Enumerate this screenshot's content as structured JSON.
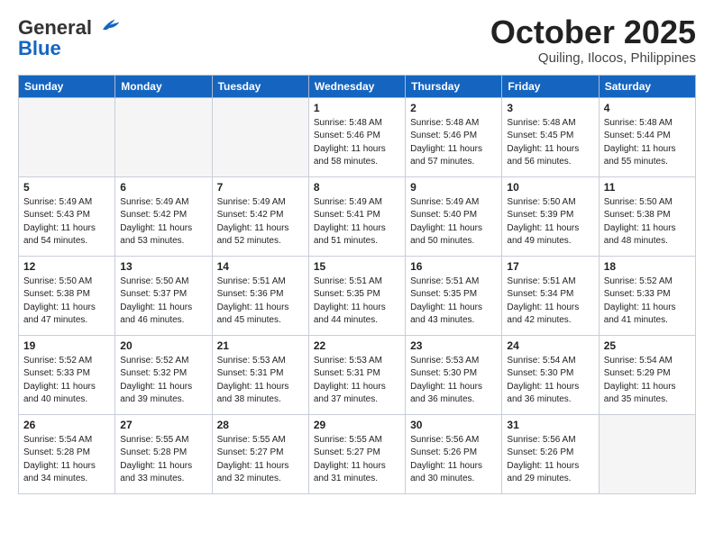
{
  "header": {
    "logo_general": "General",
    "logo_blue": "Blue",
    "month_title": "October 2025",
    "location": "Quiling, Ilocos, Philippines"
  },
  "days_of_week": [
    "Sunday",
    "Monday",
    "Tuesday",
    "Wednesday",
    "Thursday",
    "Friday",
    "Saturday"
  ],
  "weeks": [
    [
      {
        "day": "",
        "empty": true
      },
      {
        "day": "",
        "empty": true
      },
      {
        "day": "",
        "empty": true
      },
      {
        "day": "1",
        "sunrise": "Sunrise: 5:48 AM",
        "sunset": "Sunset: 5:46 PM",
        "daylight": "Daylight: 11 hours and 58 minutes."
      },
      {
        "day": "2",
        "sunrise": "Sunrise: 5:48 AM",
        "sunset": "Sunset: 5:46 PM",
        "daylight": "Daylight: 11 hours and 57 minutes."
      },
      {
        "day": "3",
        "sunrise": "Sunrise: 5:48 AM",
        "sunset": "Sunset: 5:45 PM",
        "daylight": "Daylight: 11 hours and 56 minutes."
      },
      {
        "day": "4",
        "sunrise": "Sunrise: 5:48 AM",
        "sunset": "Sunset: 5:44 PM",
        "daylight": "Daylight: 11 hours and 55 minutes."
      }
    ],
    [
      {
        "day": "5",
        "sunrise": "Sunrise: 5:49 AM",
        "sunset": "Sunset: 5:43 PM",
        "daylight": "Daylight: 11 hours and 54 minutes."
      },
      {
        "day": "6",
        "sunrise": "Sunrise: 5:49 AM",
        "sunset": "Sunset: 5:42 PM",
        "daylight": "Daylight: 11 hours and 53 minutes."
      },
      {
        "day": "7",
        "sunrise": "Sunrise: 5:49 AM",
        "sunset": "Sunset: 5:42 PM",
        "daylight": "Daylight: 11 hours and 52 minutes."
      },
      {
        "day": "8",
        "sunrise": "Sunrise: 5:49 AM",
        "sunset": "Sunset: 5:41 PM",
        "daylight": "Daylight: 11 hours and 51 minutes."
      },
      {
        "day": "9",
        "sunrise": "Sunrise: 5:49 AM",
        "sunset": "Sunset: 5:40 PM",
        "daylight": "Daylight: 11 hours and 50 minutes."
      },
      {
        "day": "10",
        "sunrise": "Sunrise: 5:50 AM",
        "sunset": "Sunset: 5:39 PM",
        "daylight": "Daylight: 11 hours and 49 minutes."
      },
      {
        "day": "11",
        "sunrise": "Sunrise: 5:50 AM",
        "sunset": "Sunset: 5:38 PM",
        "daylight": "Daylight: 11 hours and 48 minutes."
      }
    ],
    [
      {
        "day": "12",
        "sunrise": "Sunrise: 5:50 AM",
        "sunset": "Sunset: 5:38 PM",
        "daylight": "Daylight: 11 hours and 47 minutes."
      },
      {
        "day": "13",
        "sunrise": "Sunrise: 5:50 AM",
        "sunset": "Sunset: 5:37 PM",
        "daylight": "Daylight: 11 hours and 46 minutes."
      },
      {
        "day": "14",
        "sunrise": "Sunrise: 5:51 AM",
        "sunset": "Sunset: 5:36 PM",
        "daylight": "Daylight: 11 hours and 45 minutes."
      },
      {
        "day": "15",
        "sunrise": "Sunrise: 5:51 AM",
        "sunset": "Sunset: 5:35 PM",
        "daylight": "Daylight: 11 hours and 44 minutes."
      },
      {
        "day": "16",
        "sunrise": "Sunrise: 5:51 AM",
        "sunset": "Sunset: 5:35 PM",
        "daylight": "Daylight: 11 hours and 43 minutes."
      },
      {
        "day": "17",
        "sunrise": "Sunrise: 5:51 AM",
        "sunset": "Sunset: 5:34 PM",
        "daylight": "Daylight: 11 hours and 42 minutes."
      },
      {
        "day": "18",
        "sunrise": "Sunrise: 5:52 AM",
        "sunset": "Sunset: 5:33 PM",
        "daylight": "Daylight: 11 hours and 41 minutes."
      }
    ],
    [
      {
        "day": "19",
        "sunrise": "Sunrise: 5:52 AM",
        "sunset": "Sunset: 5:33 PM",
        "daylight": "Daylight: 11 hours and 40 minutes."
      },
      {
        "day": "20",
        "sunrise": "Sunrise: 5:52 AM",
        "sunset": "Sunset: 5:32 PM",
        "daylight": "Daylight: 11 hours and 39 minutes."
      },
      {
        "day": "21",
        "sunrise": "Sunrise: 5:53 AM",
        "sunset": "Sunset: 5:31 PM",
        "daylight": "Daylight: 11 hours and 38 minutes."
      },
      {
        "day": "22",
        "sunrise": "Sunrise: 5:53 AM",
        "sunset": "Sunset: 5:31 PM",
        "daylight": "Daylight: 11 hours and 37 minutes."
      },
      {
        "day": "23",
        "sunrise": "Sunrise: 5:53 AM",
        "sunset": "Sunset: 5:30 PM",
        "daylight": "Daylight: 11 hours and 36 minutes."
      },
      {
        "day": "24",
        "sunrise": "Sunrise: 5:54 AM",
        "sunset": "Sunset: 5:30 PM",
        "daylight": "Daylight: 11 hours and 36 minutes."
      },
      {
        "day": "25",
        "sunrise": "Sunrise: 5:54 AM",
        "sunset": "Sunset: 5:29 PM",
        "daylight": "Daylight: 11 hours and 35 minutes."
      }
    ],
    [
      {
        "day": "26",
        "sunrise": "Sunrise: 5:54 AM",
        "sunset": "Sunset: 5:28 PM",
        "daylight": "Daylight: 11 hours and 34 minutes."
      },
      {
        "day": "27",
        "sunrise": "Sunrise: 5:55 AM",
        "sunset": "Sunset: 5:28 PM",
        "daylight": "Daylight: 11 hours and 33 minutes."
      },
      {
        "day": "28",
        "sunrise": "Sunrise: 5:55 AM",
        "sunset": "Sunset: 5:27 PM",
        "daylight": "Daylight: 11 hours and 32 minutes."
      },
      {
        "day": "29",
        "sunrise": "Sunrise: 5:55 AM",
        "sunset": "Sunset: 5:27 PM",
        "daylight": "Daylight: 11 hours and 31 minutes."
      },
      {
        "day": "30",
        "sunrise": "Sunrise: 5:56 AM",
        "sunset": "Sunset: 5:26 PM",
        "daylight": "Daylight: 11 hours and 30 minutes."
      },
      {
        "day": "31",
        "sunrise": "Sunrise: 5:56 AM",
        "sunset": "Sunset: 5:26 PM",
        "daylight": "Daylight: 11 hours and 29 minutes."
      },
      {
        "day": "",
        "empty": true
      }
    ]
  ]
}
